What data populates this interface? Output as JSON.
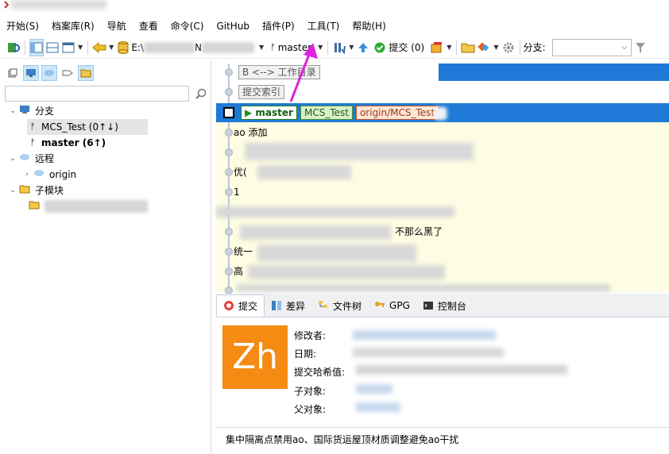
{
  "menubar": {
    "items": [
      "开始(S)",
      "档案库(R)",
      "导航",
      "查看",
      "命令(C)",
      "GitHub",
      "插件(P)",
      "工具(T)",
      "帮助(H)"
    ]
  },
  "toolbar": {
    "repo_path_prefix": "E:\\",
    "repo_path_suffix": "N",
    "current_branch": "master",
    "commit_button": "提交 (0)",
    "branch_label": "分支:",
    "branch_select_value": ""
  },
  "left_tree": {
    "branches_label": "分支",
    "branch_items": [
      {
        "label": "MCS_Test (0↑↓)",
        "selected": true
      },
      {
        "label": "master (6↑)",
        "bold": true
      }
    ],
    "remotes_label": "远程",
    "remote_items": [
      "origin"
    ],
    "submodules_label": "子模块"
  },
  "graph": {
    "workdir_label": "B <--> 工作目录",
    "index_label": "提交索引",
    "head_tags": [
      "master",
      "MCS_Test",
      "origin/MCS_Test"
    ],
    "commit_rows": [
      "ao 添加",
      "",
      "优(",
      "1",
      "",
      "不那么黑了",
      "统一",
      "高",
      ""
    ]
  },
  "tabs": [
    "提交",
    "差异",
    "文件树",
    "GPG",
    "控制台"
  ],
  "details": {
    "avatar_text": "Zh",
    "author_label": "修改者:",
    "date_label": "日期:",
    "hash_label": "提交哈希值:",
    "children_label": "子对象:",
    "parents_label": "父对象:"
  },
  "commit_message": "集中隔离点禁用ao、国际货运屋顶材质调整避免ao干扰",
  "colors": {
    "head_row": "#1e7ad6",
    "graph_bg": "#fefde3",
    "avatar": "#f58b12",
    "annotation": "#e020e0"
  }
}
